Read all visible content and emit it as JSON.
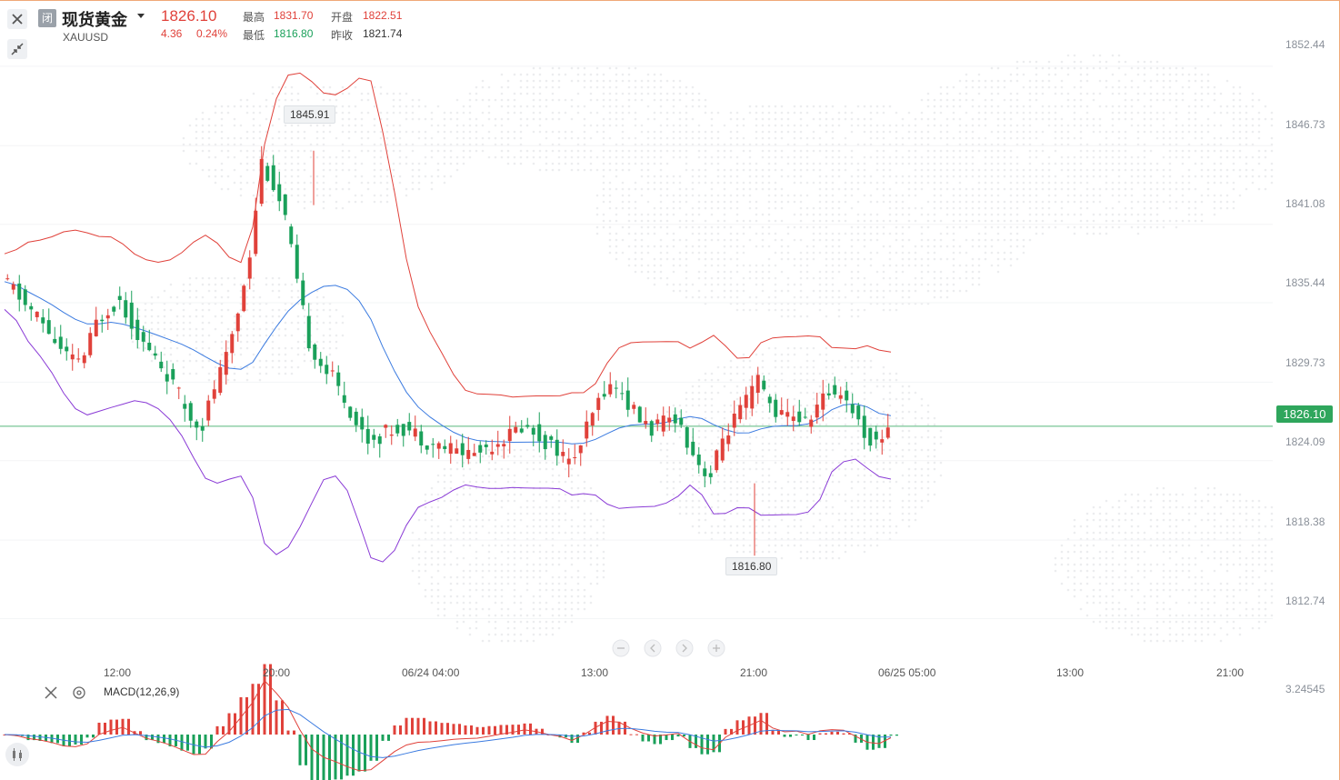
{
  "header": {
    "closed_badge": "闭",
    "title": "现货黄金",
    "symbol": "XAUUSD",
    "price": "1826.10",
    "change": "4.36",
    "change_pct": "0.24%",
    "high_label": "最高",
    "high_value": "1831.70",
    "open_label": "开盘",
    "open_value": "1822.51",
    "low_label": "最低",
    "low_value": "1816.80",
    "prev_close_label": "昨收",
    "prev_close_value": "1821.74"
  },
  "y_axis": {
    "labels": [
      "1852.44",
      "1846.73",
      "1841.08",
      "1835.44",
      "1829.73",
      "1824.09",
      "1818.38",
      "1812.74"
    ],
    "current_price": "1826.10"
  },
  "x_axis": {
    "labels": [
      "12:00",
      "20:00",
      "06/24 04:00",
      "13:00",
      "21:00",
      "06/25 05:00",
      "13:00",
      "21:00"
    ]
  },
  "annotations": {
    "max_label": "1845.91",
    "min_label": "1816.80"
  },
  "macd": {
    "label": "MACD(12,26,9)",
    "axis_top": "3.24545"
  },
  "colors": {
    "up": "#e0413a",
    "down": "#1aa05a",
    "boll_upper": "#e0413a",
    "boll_mid": "#3b7be0",
    "boll_lower": "#8a3bd6",
    "price_line": "#2fa65c"
  },
  "chart_data": {
    "type": "candlestick",
    "series_shape": "bollinger bands + MACD histogram",
    "ylim": [
      1811,
      1854
    ],
    "x": [
      "12:00",
      "20:00",
      "06/24 04:00",
      "13:00",
      "21:00",
      "06/25 05:00"
    ],
    "close_trace": [
      1836.5,
      1836.0,
      1834.8,
      1834.0,
      1832.9,
      1831.5,
      1830.8,
      1831.2,
      1833.5,
      1834.6,
      1835.2,
      1833.6,
      1832.0,
      1831.0,
      1829.8,
      1828.3,
      1826.7,
      1826.3,
      1828.9,
      1831.0,
      1834.4,
      1838.6,
      1845.2,
      1843.4,
      1841.0,
      1836.3,
      1832.2,
      1830.6,
      1829.6,
      1828.1,
      1826.3,
      1825.2,
      1825.4,
      1825.9,
      1826.0,
      1825.6,
      1825.0,
      1824.7,
      1824.5,
      1824.3,
      1824.2,
      1824.6,
      1825.1,
      1825.5,
      1826.1,
      1825.7,
      1825.0,
      1824.5,
      1823.4,
      1824.8,
      1826.9,
      1828.8,
      1829.0,
      1827.7,
      1826.6,
      1825.9,
      1826.3,
      1826.9,
      1825.1,
      1823.4,
      1822.5,
      1825.2,
      1826.6,
      1827.8,
      1829.4,
      1827.7,
      1826.8,
      1827.0,
      1826.3,
      1827.6,
      1828.5,
      1828.7,
      1827.3,
      1825.6,
      1824.8,
      1826.1
    ]
  }
}
